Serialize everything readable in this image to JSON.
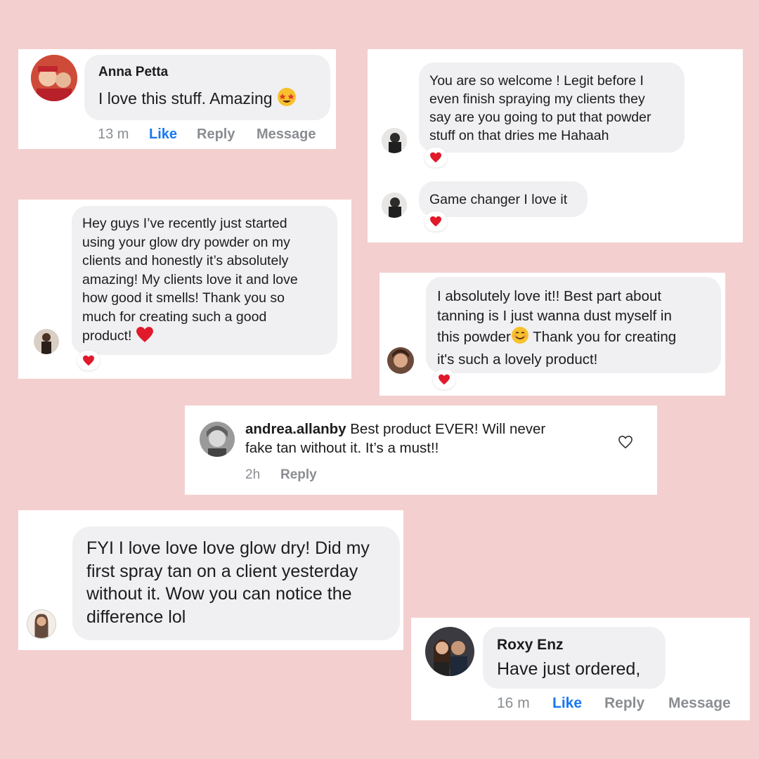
{
  "comments": {
    "anna": {
      "name": "Anna Petta",
      "text": "I love this stuff. Amazing",
      "time": "13 m",
      "like": "Like",
      "reply": "Reply",
      "message": "Message"
    },
    "welcome": {
      "text": "You are so welcome ! Legit before I\neven finish spraying my clients they\nsay are you going to put that powder\nstuff on that dries me Hahaah"
    },
    "gamechanger": {
      "text": "Game changer I love it"
    },
    "heyguys": {
      "text": "Hey guys I’ve recently just started\nusing your glow dry powder on my\nclients and honestly it’s absolutely\namazing! My clients love it and love\nhow good it smells! Thank you so\nmuch for creating such a good\nproduct!"
    },
    "absolutely": {
      "text_a": "I absolutely love it!! Best part about\ntanning is I just wanna dust myself in\nthis powder",
      "text_b": " Thank you for creating\nit's such a lovely product!"
    },
    "andrea": {
      "username": "andrea.allanby",
      "text": " Best product EVER! Will never\nfake tan without it.  It’s a must!!",
      "time": "2h",
      "reply": "Reply"
    },
    "fyi": {
      "text": "FYI I love love love glow dry! Did my\nfirst spray tan on a client yesterday\nwithout it. Wow you can notice the\ndifference lol"
    },
    "roxy": {
      "name": "Roxy Enz",
      "text": "Have just ordered,",
      "time": "16 m",
      "like": "Like",
      "reply": "Reply",
      "message": "Message"
    }
  },
  "icons": {
    "reaction": "red-heart-icon",
    "like_outline": "heart-outline-icon",
    "emoji_star": "star-struck-emoji-icon",
    "emoji_smile": "smiling-face-emoji-icon"
  },
  "colors": {
    "background": "#f4cfcf",
    "bubble": "#f0f0f2",
    "like_blue": "#1877f2",
    "heart_red": "#e0192b"
  }
}
